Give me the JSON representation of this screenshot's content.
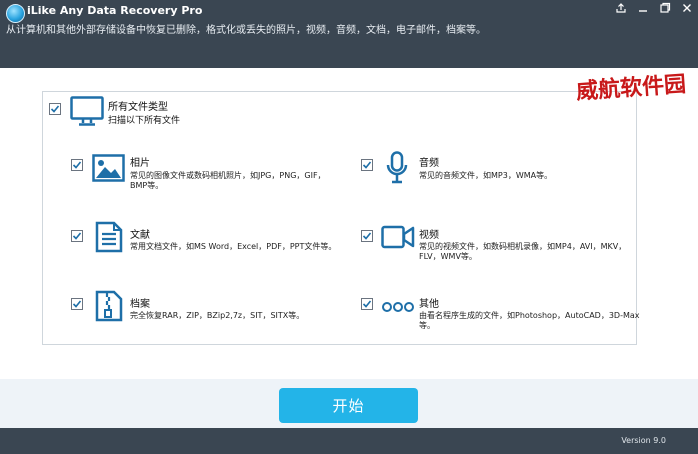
{
  "app": {
    "title": "iLike Any Data Recovery Pro",
    "subtitle": "从计算机和其他外部存储设备中恢复已删除，格式化或丢失的照片，视频，音频，文档，电子邮件，档案等。",
    "version": "Version 9.0"
  },
  "watermark": "威航软件园",
  "root": {
    "title": "所有文件类型",
    "desc": "扫描以下所有文件",
    "checked": true
  },
  "categories": {
    "photos": {
      "title": "相片",
      "desc1": "常见的图像文件或数码相机照片，如JPG，PNG，GIF，",
      "desc2": "BMP等。",
      "icon": "image-icon",
      "checked": true
    },
    "audio": {
      "title": "音频",
      "desc1": "常见的音频文件，如MP3，WMA等。",
      "icon": "microphone-icon",
      "checked": true
    },
    "documents": {
      "title": "文献",
      "desc1": "常用文档文件，如MS Word，Excel，PDF，PPT文件等。",
      "icon": "document-icon",
      "checked": true
    },
    "video": {
      "title": "视频",
      "desc1": "常见的视频文件，如数码相机录像，如MP4，AVI，MKV，",
      "desc2": "FLV，WMV等。",
      "icon": "video-camera-icon",
      "checked": true
    },
    "archives": {
      "title": "档案",
      "desc1": "完全恢复RAR，ZIP，BZip2,7z，SIT，SITX等。",
      "icon": "zip-archive-icon",
      "checked": true
    },
    "others": {
      "title": "其他",
      "desc1": "由看名程序生成的文件，如Photoshop，AutoCAD，3D-Max",
      "desc2": "等。",
      "icon": "more-dots-icon",
      "checked": true
    }
  },
  "actions": {
    "start_label": "开始"
  },
  "colors": {
    "titlebar": "#3a4652",
    "accent": "#23b4e8",
    "icon_blue": "#1e6fa8",
    "watermark": "#c8191a"
  }
}
